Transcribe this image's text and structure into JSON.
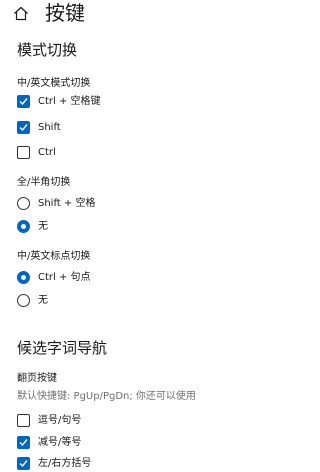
{
  "header": {
    "title": "按键",
    "home_icon": "home-icon"
  },
  "mode_switch": {
    "section_title": "模式切换",
    "cn_en_switch": {
      "label": "中/英文模式切换",
      "options": [
        {
          "label": "Ctrl + 空格键",
          "checked": true
        },
        {
          "label": "Shift",
          "checked": true
        },
        {
          "label": "Ctrl",
          "checked": false
        }
      ]
    },
    "width_switch": {
      "label": "全/半角切换",
      "options": [
        {
          "label": "Shift + 空格",
          "selected": false
        },
        {
          "label": "无",
          "selected": true
        }
      ]
    },
    "punct_switch": {
      "label": "中/英文标点切换",
      "options": [
        {
          "label": "Ctrl + 句点",
          "selected": true
        },
        {
          "label": "无",
          "selected": false
        }
      ]
    }
  },
  "candidate_nav": {
    "section_title": "候选字词导航",
    "paging": {
      "label": "翻页按键",
      "hint": "默认快捷键: PgUp/PgDn; 你还可以使用",
      "options": [
        {
          "label": "逗号/句号",
          "checked": false
        },
        {
          "label": "减号/等号",
          "checked": true
        },
        {
          "label": "左/右方括号",
          "checked": true
        }
      ]
    }
  },
  "colors": {
    "accent": "#0067c0",
    "text": "#1a1a1a",
    "hint": "#707070"
  }
}
